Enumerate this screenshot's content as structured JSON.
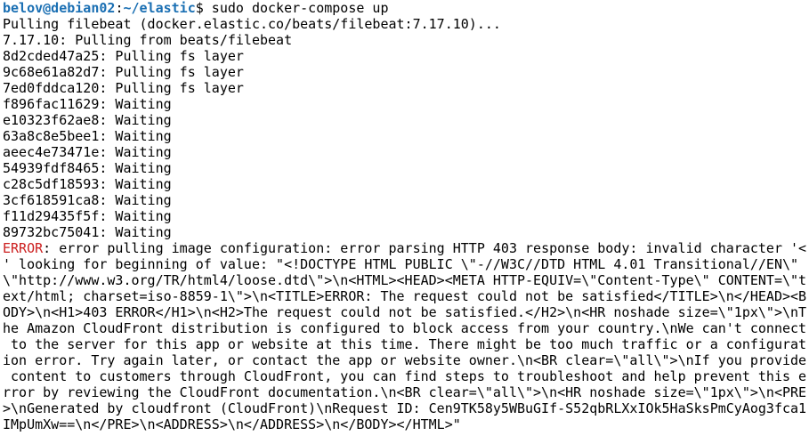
{
  "prompt": {
    "user_host": "belov@debian02",
    "separator": ":",
    "path": "~/elastic",
    "symbol": "$",
    "command": " sudo docker-compose up"
  },
  "colors": {
    "prompt": "#1a6fb3",
    "error": "#cc1f1f",
    "text": "#000000",
    "background": "#ffffff"
  },
  "output": [
    "Pulling filebeat (docker.elastic.co/beats/filebeat:7.17.10)...",
    "7.17.10: Pulling from beats/filebeat",
    "8d2cded47a25: Pulling fs layer",
    "9c68e61a82d7: Pulling fs layer",
    "7ed0fddca120: Pulling fs layer",
    "f896fac11629: Waiting",
    "e10323f62ae8: Waiting",
    "63a8c8e5bee1: Waiting",
    "aeec4e73471e: Waiting",
    "54939fdf8465: Waiting",
    "c28c5df18593: Waiting",
    "3cf618591ca8: Waiting",
    "f11d29435f5f: Waiting",
    "89732bc75041: Waiting"
  ],
  "error": {
    "label": "ERROR",
    "first_line_rest": ": error pulling image configuration: error parsing HTTP 403 response body: invalid character '<",
    "lines": [
      "' looking for beginning of value: \"<!DOCTYPE HTML PUBLIC \\\"-//W3C//DTD HTML 4.01 Transitional//EN\\\"",
      "\\\"http://www.w3.org/TR/html4/loose.dtd\\\">\\n<HTML><HEAD><META HTTP-EQUIV=\\\"Content-Type\\\" CONTENT=\\\"t",
      "ext/html; charset=iso-8859-1\\\">\\n<TITLE>ERROR: The request could not be satisfied</TITLE>\\n</HEAD><B",
      "ODY>\\n<H1>403 ERROR</H1>\\n<H2>The request could not be satisfied.</H2>\\n<HR noshade size=\\\"1px\\\">\\nT",
      "he Amazon CloudFront distribution is configured to block access from your country.\\nWe can't connect",
      " to the server for this app or website at this time. There might be too much traffic or a configurat",
      "ion error. Try again later, or contact the app or website owner.\\n<BR clear=\\\"all\\\">\\nIf you provide",
      " content to customers through CloudFront, you can find steps to troubleshoot and help prevent this e",
      "rror by reviewing the CloudFront documentation.\\n<BR clear=\\\"all\\\">\\n<HR noshade size=\\\"1px\\\">\\n<PRE",
      ">\\nGenerated by cloudfront (CloudFront)\\nRequest ID: Cen9TK58y5WBuGIf-S52qbRLXxIOk5HaSksPmCyAog3fca1",
      "IMpUmXw==\\n</PRE>\\n<ADDRESS>\\n</ADDRESS>\\n</BODY></HTML>\""
    ]
  }
}
